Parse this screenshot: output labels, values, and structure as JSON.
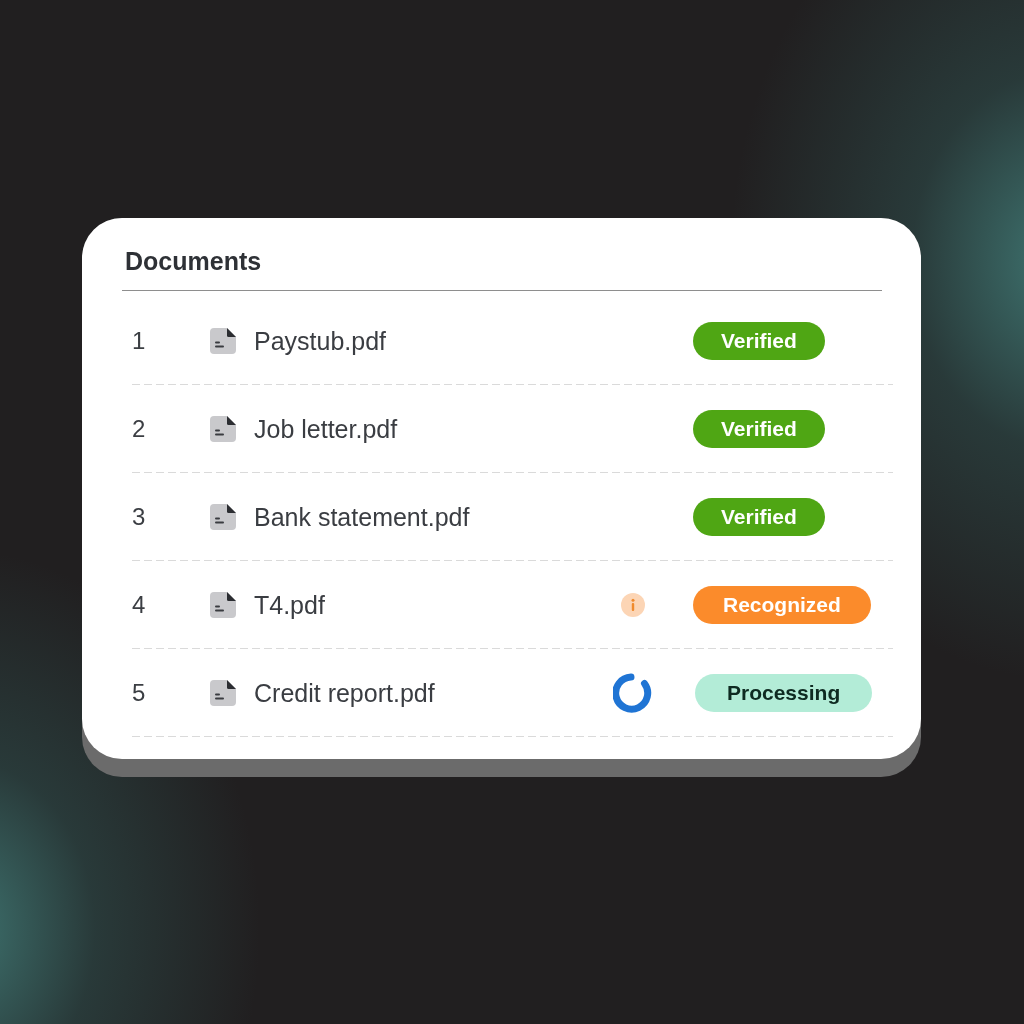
{
  "title": "Documents",
  "documents": [
    {
      "number": "1",
      "name": "Paystub.pdf",
      "status": {
        "label": "Verified",
        "kind": "verified"
      }
    },
    {
      "number": "2",
      "name": "Job letter.pdf",
      "status": {
        "label": "Verified",
        "kind": "verified"
      }
    },
    {
      "number": "3",
      "name": "Bank statement.pdf",
      "status": {
        "label": "Verified",
        "kind": "verified"
      }
    },
    {
      "number": "4",
      "name": "T4.pdf",
      "indicator": {
        "kind": "info"
      },
      "status": {
        "label": "Recognized",
        "kind": "recognized"
      }
    },
    {
      "number": "5",
      "name": "Credit report.pdf",
      "indicator": {
        "kind": "spinner"
      },
      "status": {
        "label": "Processing",
        "kind": "processing"
      }
    }
  ]
}
